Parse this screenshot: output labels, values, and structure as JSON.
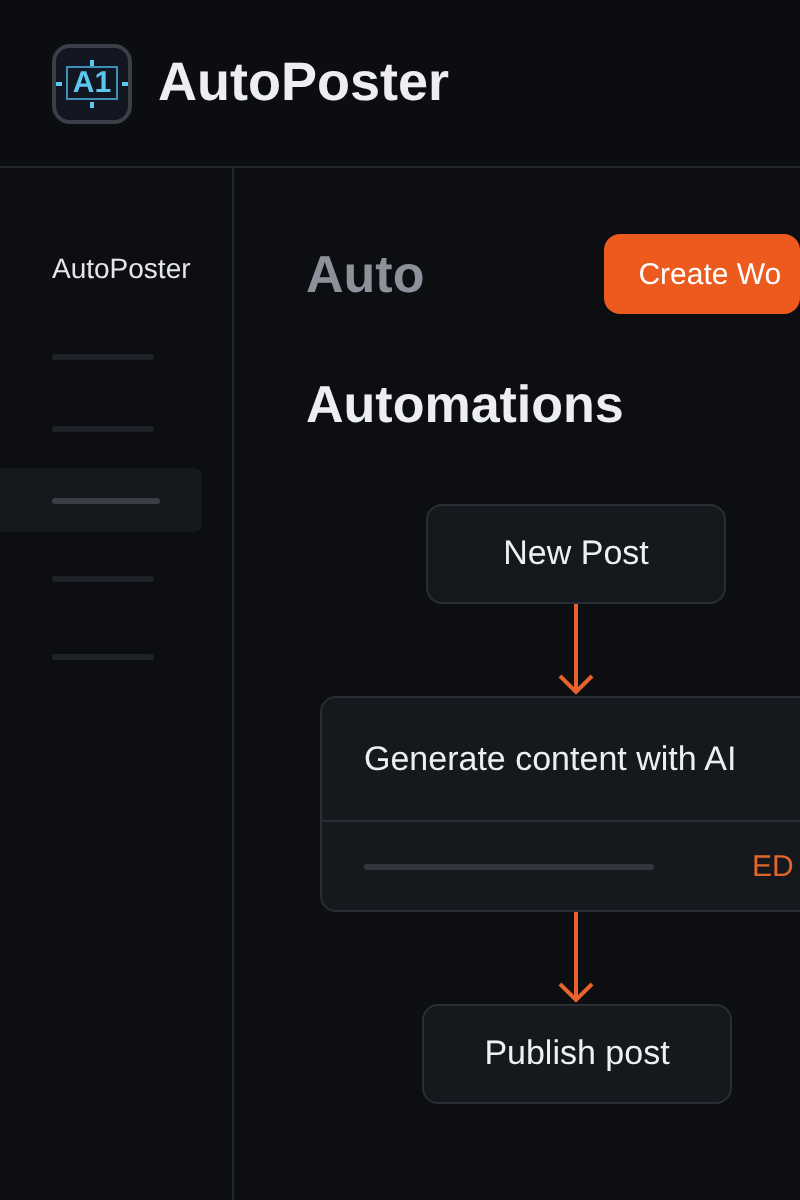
{
  "header": {
    "logo_text": "A1",
    "title": "AutoPoster"
  },
  "sidebar": {
    "title": "AutoPoster",
    "items": [
      {
        "selected": false
      },
      {
        "selected": false
      },
      {
        "selected": true
      },
      {
        "selected": false
      },
      {
        "selected": false
      }
    ]
  },
  "main": {
    "heading": "Auto",
    "create_button": "Create Wo",
    "section_title": "Automations",
    "flow": [
      {
        "kind": "node",
        "label": "New Post"
      },
      {
        "kind": "card",
        "label": "Generate content with AI",
        "action": "ED"
      },
      {
        "kind": "node",
        "label": "Publish post"
      }
    ]
  }
}
